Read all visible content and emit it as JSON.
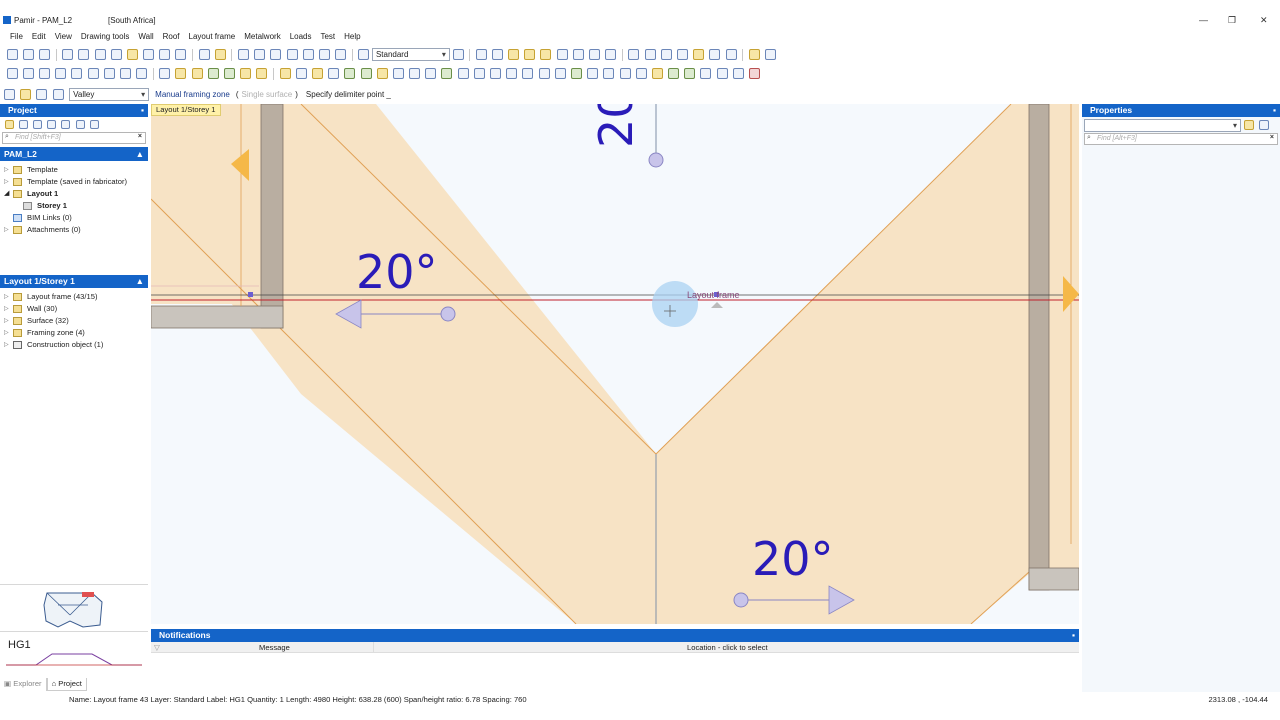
{
  "window": {
    "title": "Pamir - PAM_L2",
    "region": "[South Africa]",
    "controls": {
      "minimize": "—",
      "restore": "❐",
      "close": "✕"
    }
  },
  "menu": [
    "File",
    "Edit",
    "View",
    "Drawing tools",
    "Wall",
    "Roof",
    "Layout frame",
    "Metalwork",
    "Loads",
    "Test",
    "Help"
  ],
  "toolbar": {
    "layer_select": "Standard",
    "mode_select": "Valley"
  },
  "command": {
    "name": "Manual framing zone",
    "open_paren": "(",
    "option": "Single surface",
    "close_paren": ")",
    "prompt": "Specify delimiter point _"
  },
  "project_panel": {
    "header": "Project",
    "search_placeholder": "Find [Shift+F3]",
    "tree_title": "PAM_L2",
    "tree": [
      {
        "label": "Template",
        "bold": false
      },
      {
        "label": "Template (saved in fabricator)",
        "bold": false
      },
      {
        "label": "Layout 1",
        "bold": true
      },
      {
        "label": "Storey 1",
        "bold": true
      },
      {
        "label": "BIM Links (0)",
        "bold": false
      },
      {
        "label": "Attachments (0)",
        "bold": false
      }
    ]
  },
  "storey_panel": {
    "header": "Layout 1/Storey 1",
    "items": [
      "Layout frame (43/15)",
      "Wall (30)",
      "Surface (32)",
      "Framing zone (4)",
      "Construction object (1)"
    ]
  },
  "preview": {
    "label": "HG1"
  },
  "bottom_tabs": [
    "Explorer",
    "Project"
  ],
  "canvas": {
    "tab": "Layout 1/Storey 1",
    "angle_labels": [
      "20°",
      "20°",
      "20"
    ],
    "hover_label": "Layout frame"
  },
  "properties_panel": {
    "header": "Properties",
    "search_placeholder": "Find [Alt+F3]"
  },
  "notifications": {
    "header": "Notifications",
    "columns": [
      "Message",
      "Location - click to select"
    ]
  },
  "status": {
    "text": "Name: Layout frame 43  Layer: Standard  Label: HG1    Quantity: 1  Length: 4980  Height: 638.28 (600)  Span/height ratio: 6.78  Spacing: 760",
    "coords": "2313.08 , -104.44"
  },
  "colors": {
    "panel_header": "#1464c8",
    "frame_fill": "#f7e3c5",
    "frame_edge": "#e0a055",
    "angle_text": "#2a1cb8",
    "wall": "#b9aea1",
    "ridge_line": "#c0202a"
  }
}
